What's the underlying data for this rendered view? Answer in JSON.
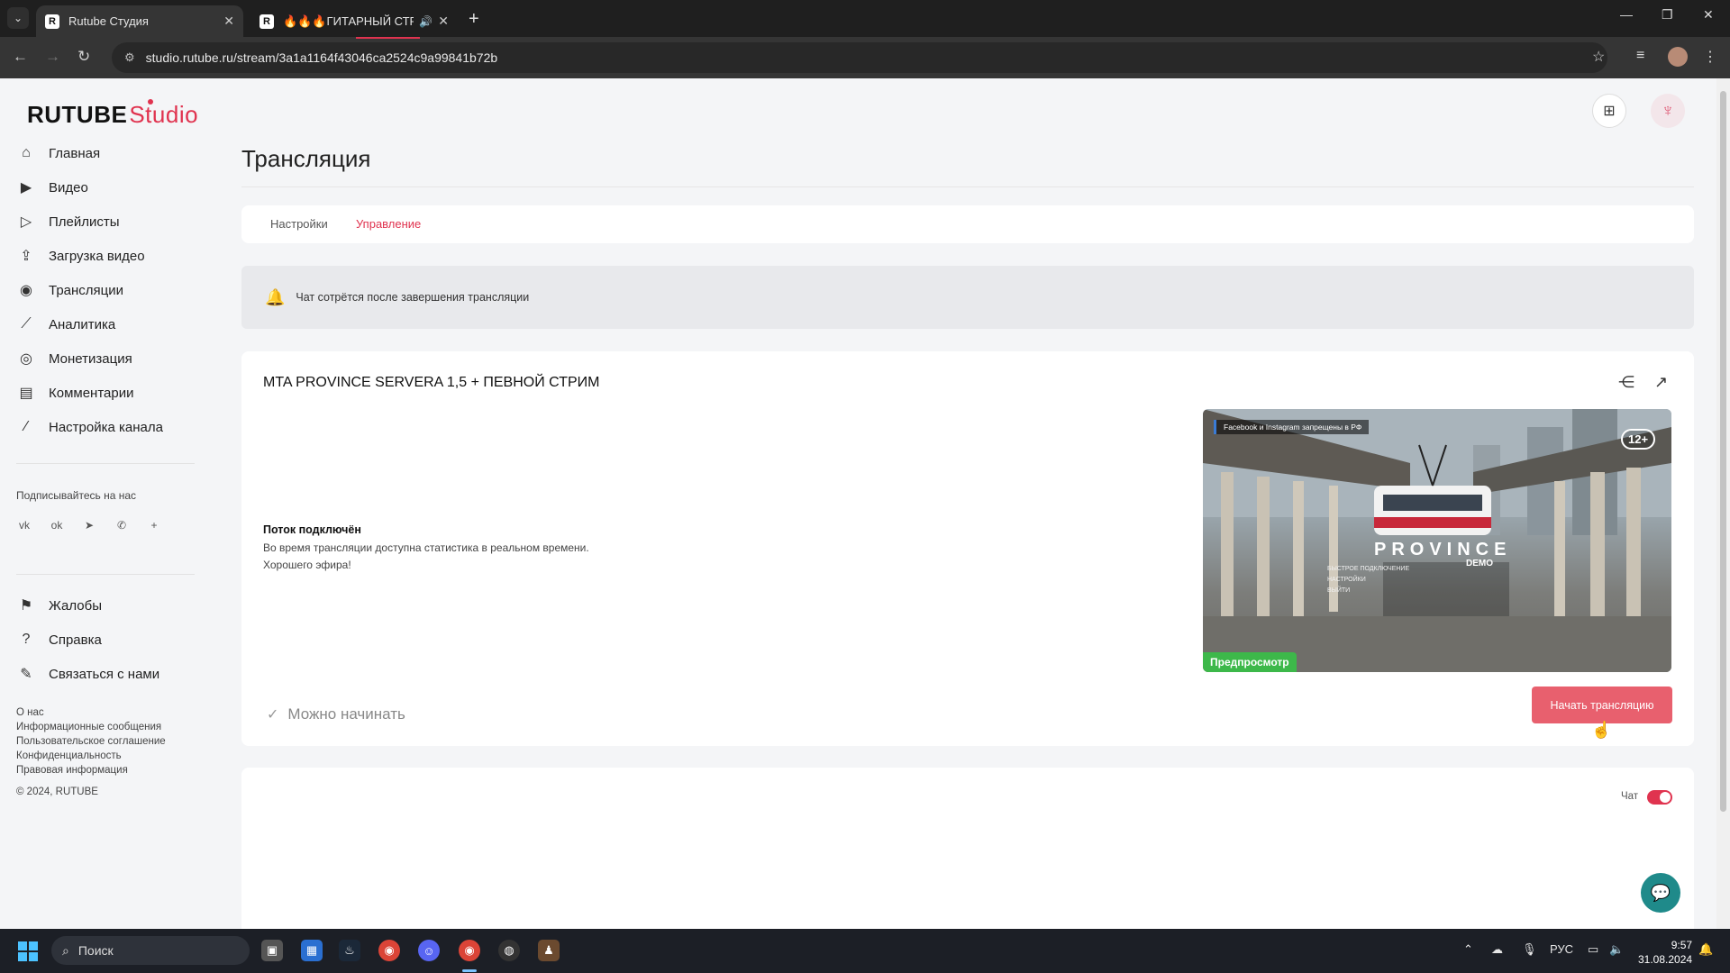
{
  "browser": {
    "tabs": [
      {
        "favicon": "R",
        "title": "Rutube Студия",
        "active": true
      },
      {
        "favicon": "R",
        "title": "🔥🔥🔥ГИТАРНЫЙ СТРИ",
        "active": false
      }
    ],
    "url_site_icon": "⚙",
    "url": "studio.rutube.ru/stream/3a1a1164f43046ca2524c9a99841b72b"
  },
  "logo": {
    "brand": "RUTUBE",
    "suffix": "Studio"
  },
  "sidebar": {
    "items": [
      {
        "label": "Главная",
        "icon": "home-icon"
      },
      {
        "label": "Видео",
        "icon": "video-icon"
      },
      {
        "label": "Плейлисты",
        "icon": "playlist-icon"
      },
      {
        "label": "Загрузка видео",
        "icon": "upload-icon"
      },
      {
        "label": "Трансляции",
        "icon": "broadcast-icon"
      },
      {
        "label": "Аналитика",
        "icon": "analytics-icon"
      },
      {
        "label": "Монетизация",
        "icon": "monetization-icon"
      },
      {
        "label": "Комментарии",
        "icon": "comments-icon"
      },
      {
        "label": "Настройка канала",
        "icon": "wand-icon"
      }
    ],
    "follow_title": "Подписывайтесь на нас",
    "socials": [
      "vk-icon",
      "ok-icon",
      "telegram-icon",
      "viber-icon",
      "more-icon"
    ],
    "bottom_items": [
      {
        "label": "Жалобы",
        "icon": "flag-icon"
      },
      {
        "label": "Справка",
        "icon": "help-icon"
      },
      {
        "label": "Связаться с нами",
        "icon": "contact-icon"
      }
    ],
    "footer_links": [
      "О нас",
      "Информационные сообщения",
      "Пользовательское соглашение",
      "Конфиденциальность",
      "Правовая информация"
    ],
    "copyright": "© 2024, RUTUBE"
  },
  "main": {
    "title": "Трансляция",
    "tabs": [
      {
        "label": "Настройки",
        "active": false
      },
      {
        "label": "Управление",
        "active": true
      }
    ],
    "notice": "Чат сотрётся после завершения трансляции",
    "stream": {
      "title": "MTA PROVINCE SERVERA 1,5 + ПЕВНОЙ СТРИМ",
      "status_title": "Поток подключён",
      "status_line1": "Во время трансляции доступна статистика в реальном времени.",
      "status_line2": "Хорошего эфира!",
      "ready_label": "Можно начинать",
      "start_button": "Начать трансляцию",
      "preview": {
        "ban_text": "Facebook и Instagram запрещены в РФ",
        "age": "12+",
        "badge": "Предпросмотр",
        "game_logo": "PROVINCE",
        "game_sub": "DEMO",
        "game_menu": [
          "БЫСТРОЕ ПОДКЛЮЧЕНИЕ",
          "НАСТРОЙКИ",
          "ВЫЙТИ"
        ]
      }
    },
    "chat": {
      "label": "Чат",
      "enabled": true
    }
  },
  "taskbar": {
    "search_placeholder": "Поиск",
    "lang": "РУС",
    "time": "9:57",
    "date": "31.08.2024"
  },
  "colors": {
    "accent": "#e0334f",
    "button": "#e8606e",
    "badge": "#3db84a",
    "fab": "#1f8a8a"
  }
}
